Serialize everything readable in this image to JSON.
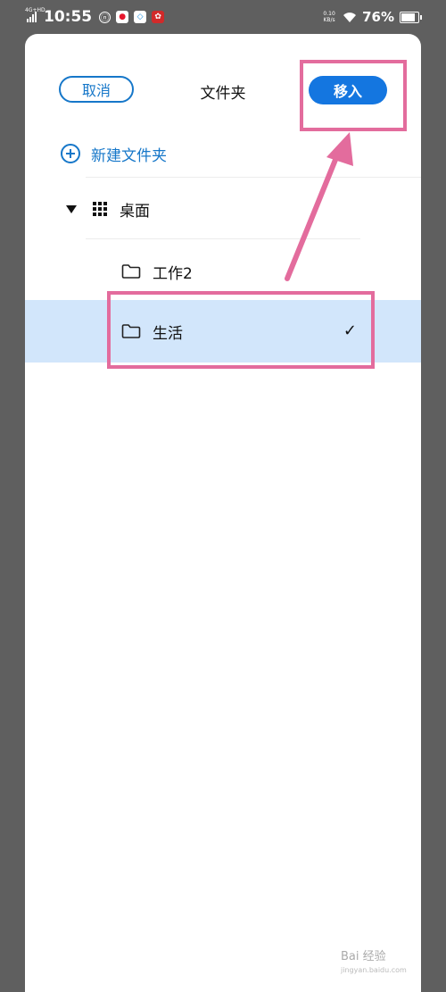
{
  "status_bar": {
    "network": "4G+HD",
    "time": "10:55",
    "speed": "0.10 KB/s",
    "battery_percent": "76%",
    "battery_level": 0.76,
    "app_icons": [
      "settings-badge-icon",
      "weibo-icon",
      "store-icon",
      "app-red-icon"
    ]
  },
  "sheet": {
    "cancel_label": "取消",
    "title": "文件夹",
    "move_label": "移入",
    "new_folder_label": "新建文件夹",
    "tree": {
      "root": "桌面",
      "children": [
        {
          "label": "工作2",
          "selected": false
        },
        {
          "label": "生活",
          "selected": true
        }
      ]
    }
  },
  "colors": {
    "accent": "#1476e0",
    "selected_row": "#d2e6fb",
    "annotation": "#e36c9d"
  },
  "watermark": {
    "text": "Bai 经验",
    "sub": "jingyan.baidu.com"
  }
}
